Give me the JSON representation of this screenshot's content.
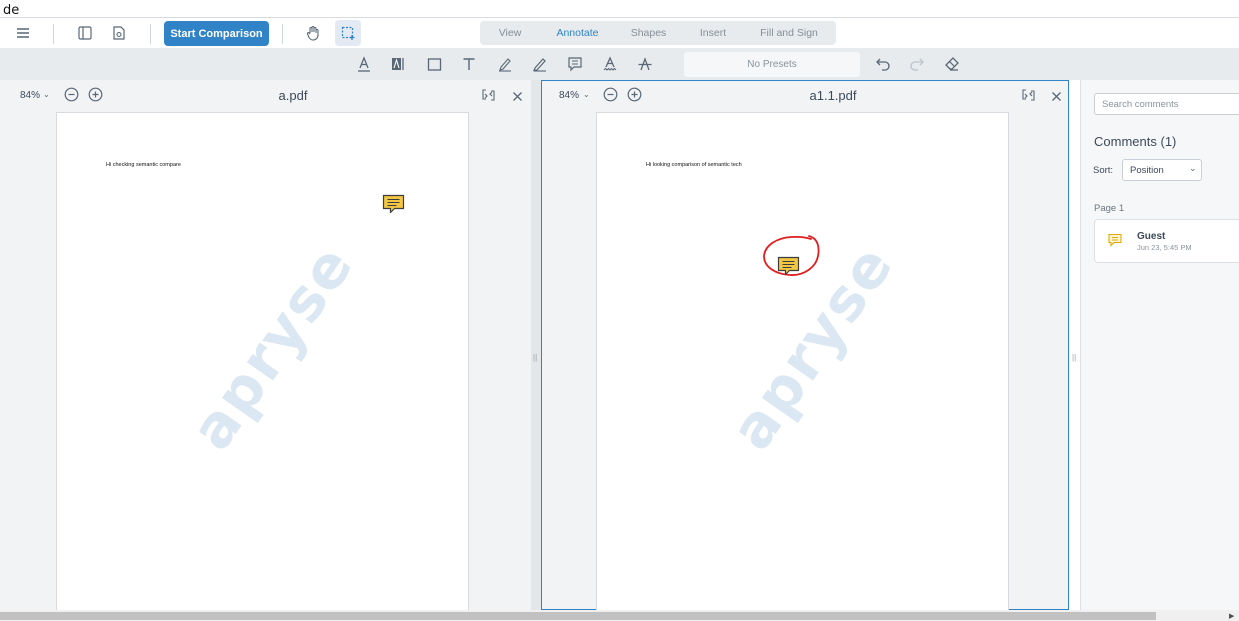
{
  "top_snippet": "de",
  "header": {
    "start_comparison_label": "Start Comparison",
    "tabs": [
      {
        "label": "View"
      },
      {
        "label": "Annotate"
      },
      {
        "label": "Shapes"
      },
      {
        "label": "Insert"
      },
      {
        "label": "Fill and Sign"
      }
    ],
    "active_tab": "Annotate"
  },
  "toolbar": {
    "presets_label": "No Presets"
  },
  "left_pane": {
    "zoom": "84%",
    "filename": "a.pdf",
    "page_text": "Hi checking semantic compare",
    "watermark": "apryse"
  },
  "right_pane": {
    "zoom": "84%",
    "filename": "a1.1.pdf",
    "page_text": "Hi looking comparison of semantic tech",
    "watermark": "apryse"
  },
  "comments_panel": {
    "search_placeholder": "Search comments",
    "title": "Comments",
    "count": "(1)",
    "sort_label": "Sort:",
    "sort_value": "Position",
    "page_group": "Page 1",
    "items": [
      {
        "author": "Guest",
        "date": "Jun 23, 5:45 PM"
      }
    ]
  },
  "colors": {
    "accent": "#3183c8",
    "toolbar_bg": "#e7ebee",
    "note_icon": "#f2c744",
    "highlight_circle": "#e01e1e"
  }
}
